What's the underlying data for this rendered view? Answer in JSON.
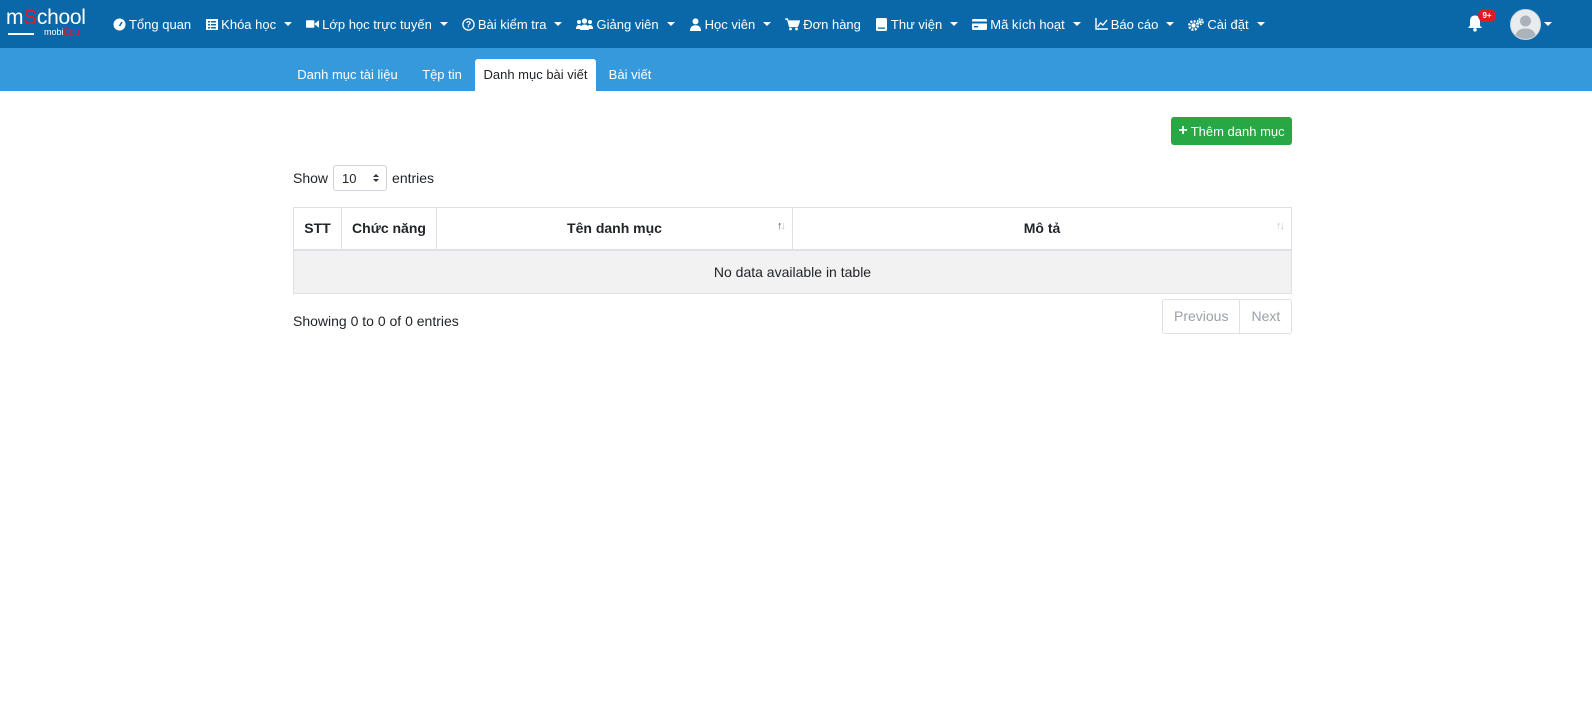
{
  "logo": {
    "main_pre": "m",
    "main_red": "S",
    "main_post": "chool",
    "sub_pre": "mobi",
    "sub_red": "Edu"
  },
  "nav": {
    "items": [
      {
        "icon": "dashboard-gauge-icon",
        "label": "Tổng quan",
        "has_dropdown": false
      },
      {
        "icon": "list-icon",
        "label": "Khóa học",
        "has_dropdown": true
      },
      {
        "icon": "video-camera-icon",
        "label": "Lớp học trực tuyến",
        "has_dropdown": true
      },
      {
        "icon": "question-circle-icon",
        "label": "Bài kiểm tra",
        "has_dropdown": true
      },
      {
        "icon": "users-icon",
        "label": "Giảng viên",
        "has_dropdown": true
      },
      {
        "icon": "user-icon",
        "label": "Học viên",
        "has_dropdown": true
      },
      {
        "icon": "shopping-cart-icon",
        "label": "Đơn hàng",
        "has_dropdown": false
      },
      {
        "icon": "book-icon",
        "label": "Thư viện",
        "has_dropdown": true
      },
      {
        "icon": "credit-card-icon",
        "label": "Mã kích hoạt",
        "has_dropdown": true
      },
      {
        "icon": "line-chart-icon",
        "label": "Báo cáo",
        "has_dropdown": true
      },
      {
        "icon": "gears-icon",
        "label": "Cài đặt",
        "has_dropdown": true
      }
    ]
  },
  "notifications": {
    "badge": "9+"
  },
  "tabs": [
    {
      "label": "Danh mục tài liệu",
      "active": false
    },
    {
      "label": "Tệp tin",
      "active": false
    },
    {
      "label": "Danh mục bài viết",
      "active": true
    },
    {
      "label": "Bài viết",
      "active": false
    }
  ],
  "add_button": {
    "label": "Thêm danh mục"
  },
  "length_menu": {
    "prefix": "Show",
    "value": "10",
    "suffix": "entries"
  },
  "table": {
    "columns": [
      "STT",
      "Chức năng",
      "Tên danh mục",
      "Mô tả"
    ],
    "empty_message": "No data available in table"
  },
  "info": "Showing 0 to 0 of 0 entries",
  "pagination": {
    "previous": "Previous",
    "next": "Next"
  },
  "colors": {
    "navbar": "#0a68a8",
    "subbar": "#3599dc",
    "add_button": "#28a745",
    "badge": "#e01b24"
  }
}
